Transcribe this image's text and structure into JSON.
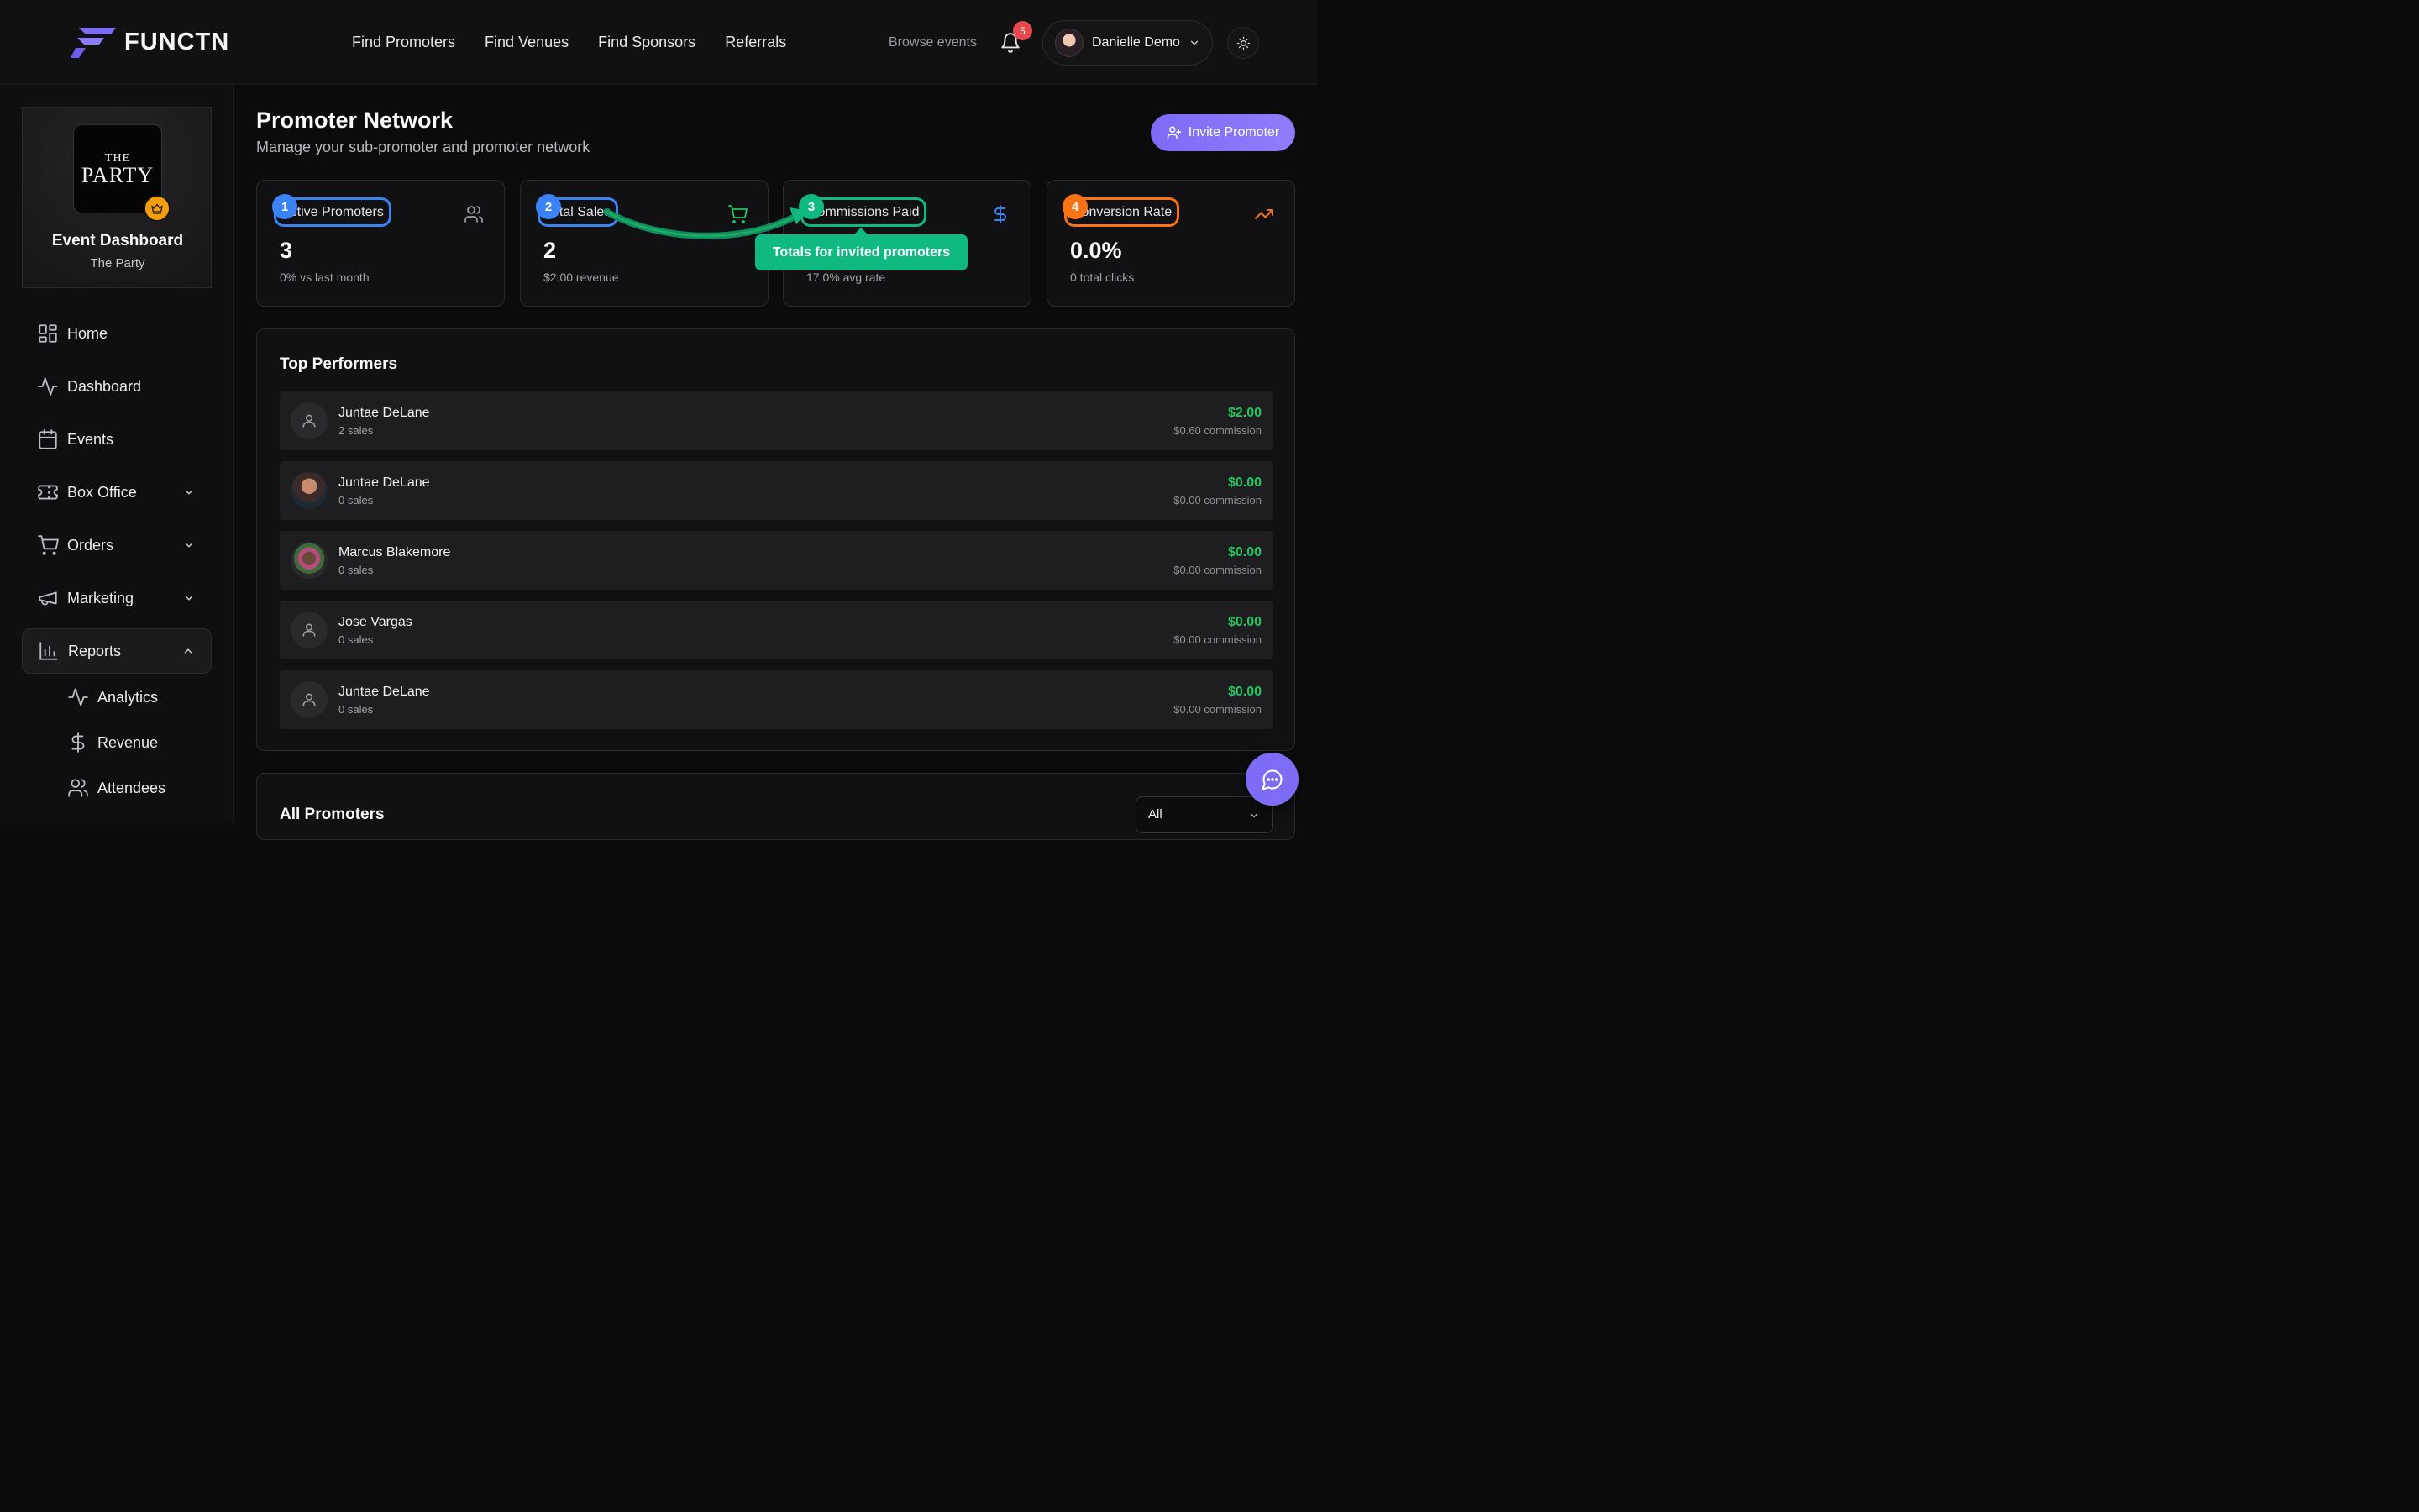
{
  "brand": {
    "name": "FUNCTN"
  },
  "nav": [
    "Find Promoters",
    "Find Venues",
    "Find Sponsors",
    "Referrals"
  ],
  "header": {
    "browse": "Browse events",
    "notifications": "5",
    "user": "Danielle Demo"
  },
  "event": {
    "logo_line1": "THE",
    "logo_line2": "PARTY",
    "title": "Event Dashboard",
    "name": "The Party"
  },
  "sidebar": {
    "items": [
      {
        "label": "Home"
      },
      {
        "label": "Dashboard"
      },
      {
        "label": "Events"
      },
      {
        "label": "Box Office"
      },
      {
        "label": "Orders"
      },
      {
        "label": "Marketing"
      },
      {
        "label": "Reports"
      }
    ],
    "sub_items": [
      {
        "label": "Analytics"
      },
      {
        "label": "Revenue"
      },
      {
        "label": "Attendees"
      }
    ]
  },
  "page": {
    "title": "Promoter Network",
    "subtitle": "Manage your sub-promoter and promoter network",
    "invite": "Invite Promoter"
  },
  "stats": [
    {
      "num": "1",
      "label": "Active Promoters",
      "value": "3",
      "foot": "0% vs last month",
      "color": "#3b82f6"
    },
    {
      "num": "2",
      "label": "Total Sales",
      "value": "2",
      "foot": "$2.00 revenue",
      "color": "#3b82f6"
    },
    {
      "num": "3",
      "label": "Commissions Paid",
      "value": "",
      "foot": "17.0% avg rate",
      "color": "#10b981"
    },
    {
      "num": "4",
      "label": "Conversion Rate",
      "value": "0.0%",
      "foot": "0 total clicks",
      "color": "#f97316"
    }
  ],
  "tooltip": "Totals for invited promoters",
  "top_performers": {
    "title": "Top Performers",
    "rows": [
      {
        "name": "Juntae DeLane",
        "sales": "2 sales",
        "amount": "$2.00",
        "commission": "$0.60 commission"
      },
      {
        "name": "Juntae DeLane",
        "sales": "0 sales",
        "amount": "$0.00",
        "commission": "$0.00 commission"
      },
      {
        "name": "Marcus Blakemore",
        "sales": "0 sales",
        "amount": "$0.00",
        "commission": "$0.00 commission"
      },
      {
        "name": "Jose Vargas",
        "sales": "0 sales",
        "amount": "$0.00",
        "commission": "$0.00 commission"
      },
      {
        "name": "Juntae DeLane",
        "sales": "0 sales",
        "amount": "$0.00",
        "commission": "$0.00 commission"
      }
    ]
  },
  "all_promoters": {
    "title": "All Promoters",
    "filter": "All"
  }
}
